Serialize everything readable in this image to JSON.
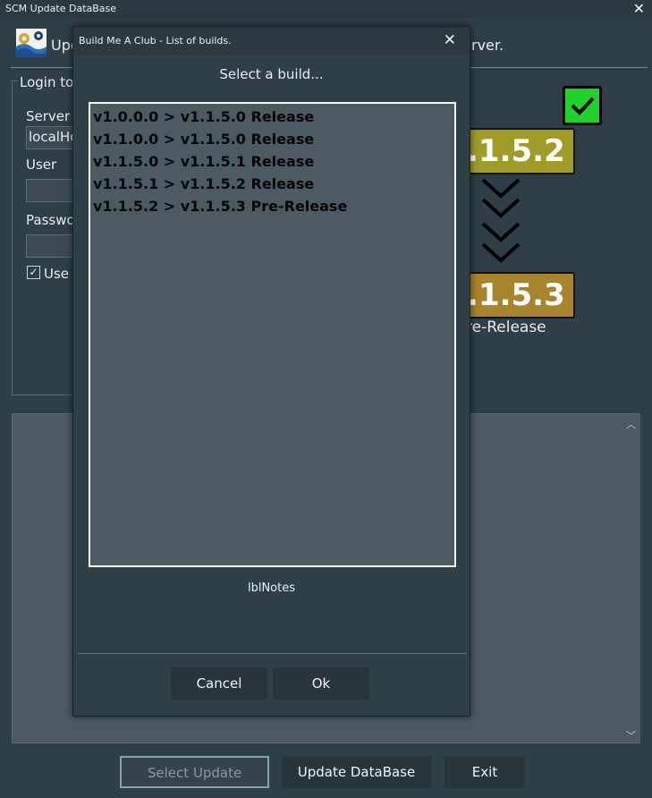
{
  "window": {
    "title": "SCM Update DataBase",
    "close_glyph": "✕",
    "header_left": "Upd",
    "header_right": "rver.",
    "logo_icon": "app-logo-icon"
  },
  "login": {
    "legend": "Login to",
    "server_label": "Server I",
    "server_value": "localHo",
    "user_label": "User",
    "password_label": "Passwo",
    "use_label": "Use",
    "use_checked": true
  },
  "versions": {
    "current": ".1.5.2",
    "target": ".1.5.3",
    "target_type": "re-Release",
    "current_color": "#a19b27",
    "target_color": "#a8842a",
    "ok_color": "#20d32a"
  },
  "buttons": {
    "select_update": "Select Update",
    "update_database": "Update DataBase",
    "exit": "Exit"
  },
  "dialog": {
    "title": "Build Me A Club - List of builds.",
    "close_glyph": "✕",
    "prompt": "Select a build...",
    "builds": [
      "v1.0.0.0 > v1.1.5.0 Release",
      "v1.1.0.0 > v1.1.5.0 Release",
      "v1.1.5.0 > v1.1.5.1 Release",
      "v1.1.5.1 > v1.1.5.2 Release",
      "v1.1.5.2 > v1.1.5.3 Pre-Release"
    ],
    "notes_label": "lblNotes",
    "cancel": "Cancel",
    "ok": "Ok"
  }
}
